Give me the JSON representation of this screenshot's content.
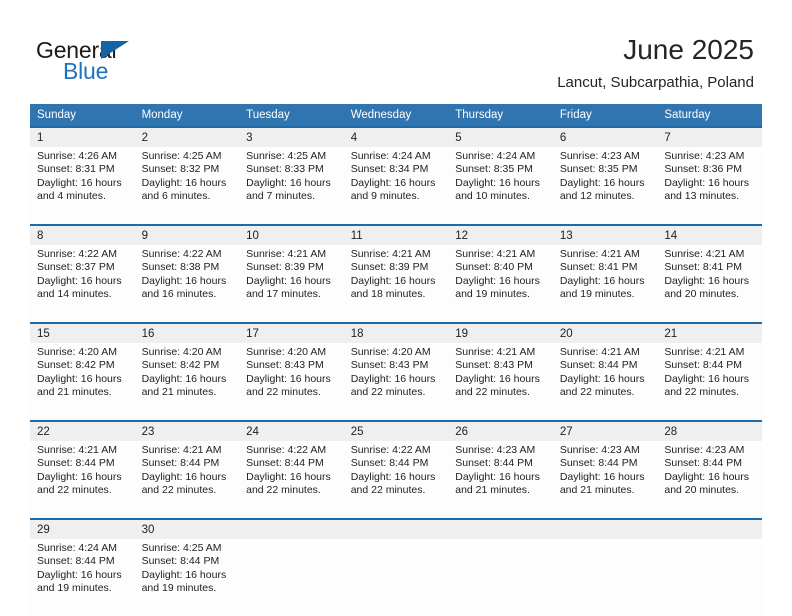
{
  "brand": {
    "name_top": "General",
    "name_bottom": "Blue",
    "triangle_color": "#1464a5",
    "bottom_color": "#1e73be"
  },
  "header": {
    "title": "June 2025",
    "subtitle": "Lancut, Subcarpathia, Poland"
  },
  "theme": {
    "header_blue": "#3175b0",
    "separator_blue": "#1c6aa8",
    "daynum_band": "#efefef",
    "cell_bg": "#fdfdfd",
    "text": "#222222"
  },
  "calendar": {
    "weekday_headers": [
      "Sunday",
      "Monday",
      "Tuesday",
      "Wednesday",
      "Thursday",
      "Friday",
      "Saturday"
    ],
    "weeks": [
      [
        {
          "day": "1",
          "sunrise": "Sunrise: 4:26 AM",
          "sunset": "Sunset: 8:31 PM",
          "daylight_line1": "Daylight: 16 hours",
          "daylight_line2": "and 4 minutes."
        },
        {
          "day": "2",
          "sunrise": "Sunrise: 4:25 AM",
          "sunset": "Sunset: 8:32 PM",
          "daylight_line1": "Daylight: 16 hours",
          "daylight_line2": "and 6 minutes."
        },
        {
          "day": "3",
          "sunrise": "Sunrise: 4:25 AM",
          "sunset": "Sunset: 8:33 PM",
          "daylight_line1": "Daylight: 16 hours",
          "daylight_line2": "and 7 minutes."
        },
        {
          "day": "4",
          "sunrise": "Sunrise: 4:24 AM",
          "sunset": "Sunset: 8:34 PM",
          "daylight_line1": "Daylight: 16 hours",
          "daylight_line2": "and 9 minutes."
        },
        {
          "day": "5",
          "sunrise": "Sunrise: 4:24 AM",
          "sunset": "Sunset: 8:35 PM",
          "daylight_line1": "Daylight: 16 hours",
          "daylight_line2": "and 10 minutes."
        },
        {
          "day": "6",
          "sunrise": "Sunrise: 4:23 AM",
          "sunset": "Sunset: 8:35 PM",
          "daylight_line1": "Daylight: 16 hours",
          "daylight_line2": "and 12 minutes."
        },
        {
          "day": "7",
          "sunrise": "Sunrise: 4:23 AM",
          "sunset": "Sunset: 8:36 PM",
          "daylight_line1": "Daylight: 16 hours",
          "daylight_line2": "and 13 minutes."
        }
      ],
      [
        {
          "day": "8",
          "sunrise": "Sunrise: 4:22 AM",
          "sunset": "Sunset: 8:37 PM",
          "daylight_line1": "Daylight: 16 hours",
          "daylight_line2": "and 14 minutes."
        },
        {
          "day": "9",
          "sunrise": "Sunrise: 4:22 AM",
          "sunset": "Sunset: 8:38 PM",
          "daylight_line1": "Daylight: 16 hours",
          "daylight_line2": "and 16 minutes."
        },
        {
          "day": "10",
          "sunrise": "Sunrise: 4:21 AM",
          "sunset": "Sunset: 8:39 PM",
          "daylight_line1": "Daylight: 16 hours",
          "daylight_line2": "and 17 minutes."
        },
        {
          "day": "11",
          "sunrise": "Sunrise: 4:21 AM",
          "sunset": "Sunset: 8:39 PM",
          "daylight_line1": "Daylight: 16 hours",
          "daylight_line2": "and 18 minutes."
        },
        {
          "day": "12",
          "sunrise": "Sunrise: 4:21 AM",
          "sunset": "Sunset: 8:40 PM",
          "daylight_line1": "Daylight: 16 hours",
          "daylight_line2": "and 19 minutes."
        },
        {
          "day": "13",
          "sunrise": "Sunrise: 4:21 AM",
          "sunset": "Sunset: 8:41 PM",
          "daylight_line1": "Daylight: 16 hours",
          "daylight_line2": "and 19 minutes."
        },
        {
          "day": "14",
          "sunrise": "Sunrise: 4:21 AM",
          "sunset": "Sunset: 8:41 PM",
          "daylight_line1": "Daylight: 16 hours",
          "daylight_line2": "and 20 minutes."
        }
      ],
      [
        {
          "day": "15",
          "sunrise": "Sunrise: 4:20 AM",
          "sunset": "Sunset: 8:42 PM",
          "daylight_line1": "Daylight: 16 hours",
          "daylight_line2": "and 21 minutes."
        },
        {
          "day": "16",
          "sunrise": "Sunrise: 4:20 AM",
          "sunset": "Sunset: 8:42 PM",
          "daylight_line1": "Daylight: 16 hours",
          "daylight_line2": "and 21 minutes."
        },
        {
          "day": "17",
          "sunrise": "Sunrise: 4:20 AM",
          "sunset": "Sunset: 8:43 PM",
          "daylight_line1": "Daylight: 16 hours",
          "daylight_line2": "and 22 minutes."
        },
        {
          "day": "18",
          "sunrise": "Sunrise: 4:20 AM",
          "sunset": "Sunset: 8:43 PM",
          "daylight_line1": "Daylight: 16 hours",
          "daylight_line2": "and 22 minutes."
        },
        {
          "day": "19",
          "sunrise": "Sunrise: 4:21 AM",
          "sunset": "Sunset: 8:43 PM",
          "daylight_line1": "Daylight: 16 hours",
          "daylight_line2": "and 22 minutes."
        },
        {
          "day": "20",
          "sunrise": "Sunrise: 4:21 AM",
          "sunset": "Sunset: 8:44 PM",
          "daylight_line1": "Daylight: 16 hours",
          "daylight_line2": "and 22 minutes."
        },
        {
          "day": "21",
          "sunrise": "Sunrise: 4:21 AM",
          "sunset": "Sunset: 8:44 PM",
          "daylight_line1": "Daylight: 16 hours",
          "daylight_line2": "and 22 minutes."
        }
      ],
      [
        {
          "day": "22",
          "sunrise": "Sunrise: 4:21 AM",
          "sunset": "Sunset: 8:44 PM",
          "daylight_line1": "Daylight: 16 hours",
          "daylight_line2": "and 22 minutes."
        },
        {
          "day": "23",
          "sunrise": "Sunrise: 4:21 AM",
          "sunset": "Sunset: 8:44 PM",
          "daylight_line1": "Daylight: 16 hours",
          "daylight_line2": "and 22 minutes."
        },
        {
          "day": "24",
          "sunrise": "Sunrise: 4:22 AM",
          "sunset": "Sunset: 8:44 PM",
          "daylight_line1": "Daylight: 16 hours",
          "daylight_line2": "and 22 minutes."
        },
        {
          "day": "25",
          "sunrise": "Sunrise: 4:22 AM",
          "sunset": "Sunset: 8:44 PM",
          "daylight_line1": "Daylight: 16 hours",
          "daylight_line2": "and 22 minutes."
        },
        {
          "day": "26",
          "sunrise": "Sunrise: 4:23 AM",
          "sunset": "Sunset: 8:44 PM",
          "daylight_line1": "Daylight: 16 hours",
          "daylight_line2": "and 21 minutes."
        },
        {
          "day": "27",
          "sunrise": "Sunrise: 4:23 AM",
          "sunset": "Sunset: 8:44 PM",
          "daylight_line1": "Daylight: 16 hours",
          "daylight_line2": "and 21 minutes."
        },
        {
          "day": "28",
          "sunrise": "Sunrise: 4:23 AM",
          "sunset": "Sunset: 8:44 PM",
          "daylight_line1": "Daylight: 16 hours",
          "daylight_line2": "and 20 minutes."
        }
      ],
      [
        {
          "day": "29",
          "sunrise": "Sunrise: 4:24 AM",
          "sunset": "Sunset: 8:44 PM",
          "daylight_line1": "Daylight: 16 hours",
          "daylight_line2": "and 19 minutes."
        },
        {
          "day": "30",
          "sunrise": "Sunrise: 4:25 AM",
          "sunset": "Sunset: 8:44 PM",
          "daylight_line1": "Daylight: 16 hours",
          "daylight_line2": "and 19 minutes."
        },
        {
          "day": "",
          "sunrise": "",
          "sunset": "",
          "daylight_line1": "",
          "daylight_line2": ""
        },
        {
          "day": "",
          "sunrise": "",
          "sunset": "",
          "daylight_line1": "",
          "daylight_line2": ""
        },
        {
          "day": "",
          "sunrise": "",
          "sunset": "",
          "daylight_line1": "",
          "daylight_line2": ""
        },
        {
          "day": "",
          "sunrise": "",
          "sunset": "",
          "daylight_line1": "",
          "daylight_line2": ""
        },
        {
          "day": "",
          "sunrise": "",
          "sunset": "",
          "daylight_line1": "",
          "daylight_line2": ""
        }
      ]
    ]
  }
}
